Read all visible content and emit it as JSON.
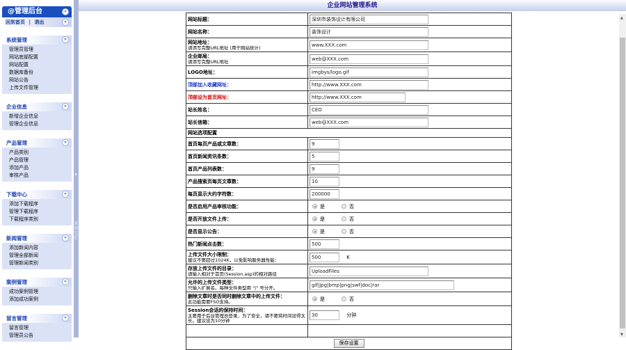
{
  "sidebar": {
    "title": "@管理后台",
    "home": "回到首页",
    "sep": "|",
    "logout": "退出",
    "sections": [
      {
        "title": "系统管理",
        "items": [
          "管理员管理",
          "网站底部配置",
          "网站配置",
          "数据库备份",
          "网站公告",
          "上传文件管理"
        ]
      },
      {
        "title": "企业信息",
        "items": [
          "新增企业信息",
          "管理企业信息"
        ]
      },
      {
        "title": "产品管理",
        "items": [
          "产品类别",
          "产品管理",
          "添加产品",
          "审核产品"
        ]
      },
      {
        "title": "下载中心",
        "items": [
          "添加下载程序",
          "管理下载程序",
          "下载程序类别"
        ]
      },
      {
        "title": "新闻管理",
        "items": [
          "添加新闻内容",
          "管理全部新闻",
          "管理新闻类别"
        ]
      },
      {
        "title": "案例管理",
        "items": [
          "成功案例管理",
          "添加成功案例"
        ]
      },
      {
        "title": "留言管理",
        "items": [
          "留言管理",
          "管理员公告"
        ]
      }
    ],
    "splitter_label": "关闭左栏"
  },
  "header": {
    "title": "企业网站管理系统"
  },
  "form": {
    "site_title": {
      "label": "网站标题：",
      "value": "深圳市装饰设计有限公司"
    },
    "site_name": {
      "label": "网站名称：",
      "value": "装饰设计"
    },
    "site_url": {
      "label": "网站地址：",
      "hint": "请添写完整URL地址 (用于网站统计)",
      "value": "www.XXX.com"
    },
    "site_mail": {
      "label": "企业邮局：",
      "hint": "请添写完整URL地址",
      "value": "web@XXX.com"
    },
    "logo": {
      "label": "LOGO地址：",
      "value": "imgbys/logo.gif"
    },
    "fav_url": {
      "label": "顶部加入收藏网址：",
      "value": "http://www.XXX.com"
    },
    "home_url": {
      "label": "顶部设为首页网址：",
      "value": "http://www.XXX.com"
    },
    "owner_name": {
      "label": "站长姓名：",
      "value": "CEO"
    },
    "owner_mail": {
      "label": "站长信箱：",
      "value": "web@XXX.com"
    },
    "options_heading": "网站选项配置",
    "per_page": {
      "label": "首页每页产品或文章数：",
      "value": "9"
    },
    "news_count": {
      "label": "首页新闻资讯条数：",
      "value": "5"
    },
    "product_list": {
      "label": "首页产品列表数：",
      "value": "9"
    },
    "search_per_page": {
      "label": "产品搜索页每页文章数：",
      "value": "10"
    },
    "max_chars": {
      "label": "每页显示大约字符数：",
      "value": "200000"
    },
    "audit": {
      "label": "是否启用产品审核功能：",
      "yes": "是",
      "no": "否",
      "selected": "yes"
    },
    "upload_open": {
      "label": "是否开放文件上传：",
      "yes": "是",
      "no": "否",
      "selected": "yes"
    },
    "show_notice": {
      "label": "是否显示公告：",
      "yes": "是",
      "no": "否",
      "selected": "yes"
    },
    "hot_clicks": {
      "label": "热门新闻点击数：",
      "value": "500"
    },
    "upload_size": {
      "label": "上传文件大小限制：",
      "hint": "建议不要超过1024K，以免影响服务器性能：",
      "value": "500",
      "unit": "K"
    },
    "upload_dir": {
      "label": "存放上传文件的目录：",
      "hint": "请输入相对于首页(Session.asp)的相对路径",
      "value": "UploadFiles"
    },
    "upload_types": {
      "label": "允许的上传文件类型：",
      "hint": "只输入扩展名。每种文件类型用 \"|\" 号分开。",
      "value": "gif|jpg|bmp|png|swf|doc|rar"
    },
    "delete_files": {
      "label": "删除文章时是否同时删除文章中的上传文件：",
      "hint": "此功能需要FSO支持。",
      "yes": "是",
      "no": "否",
      "selected": "yes"
    },
    "session": {
      "label": "Session会话的保持时间：",
      "hint": "主要用于后台管理员登录，为了安全，请不要将时间设得太长。建议设为10分钟",
      "value": "30",
      "unit": "分钟"
    },
    "save_label": "保存设置"
  }
}
